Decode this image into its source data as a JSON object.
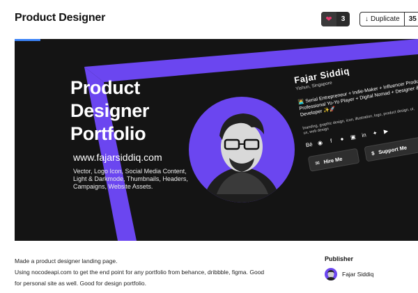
{
  "header": {
    "title": "Product Designer",
    "like_count": "3",
    "duplicate_label": "Duplicate",
    "duplicate_count": "35"
  },
  "banner": {
    "hero_title_lines": [
      "Product",
      "Designer",
      "Portfolio"
    ],
    "url": "www.fajarsiddiq.com",
    "description": "Vector, Logo Icon, Social Media Content, Light & Darkmode, Thumbnails, Headers, Campaigns, Website Assets.",
    "card": {
      "name": "Fajar Siddiq",
      "location": "Yishun, Singapore",
      "bio": "🧑‍💻 Serial Entrepreneur + Indie-Maker + Influencer Producer + Professional Yo-Yo Player + Digital Nomad + Designer & Developer ✨🚀",
      "tags": "branding, graphic design, icon, illustration, logo, product design, ui, ux, web design",
      "hire_label": "Hire Me",
      "support_label": "Support Me"
    },
    "colors": {
      "background": "#141414",
      "purple": "#6b46f0",
      "accent": "#3b82f6"
    }
  },
  "about": {
    "lines": [
      "Made a product designer landing page.",
      "Using nocodeapi.com to get the end point for any portfolio from behance, dribbble, figma. Good",
      "for personal site as well. Good for design portfolio."
    ]
  },
  "publisher": {
    "heading": "Publisher",
    "name": "Fajar Siddiq"
  }
}
